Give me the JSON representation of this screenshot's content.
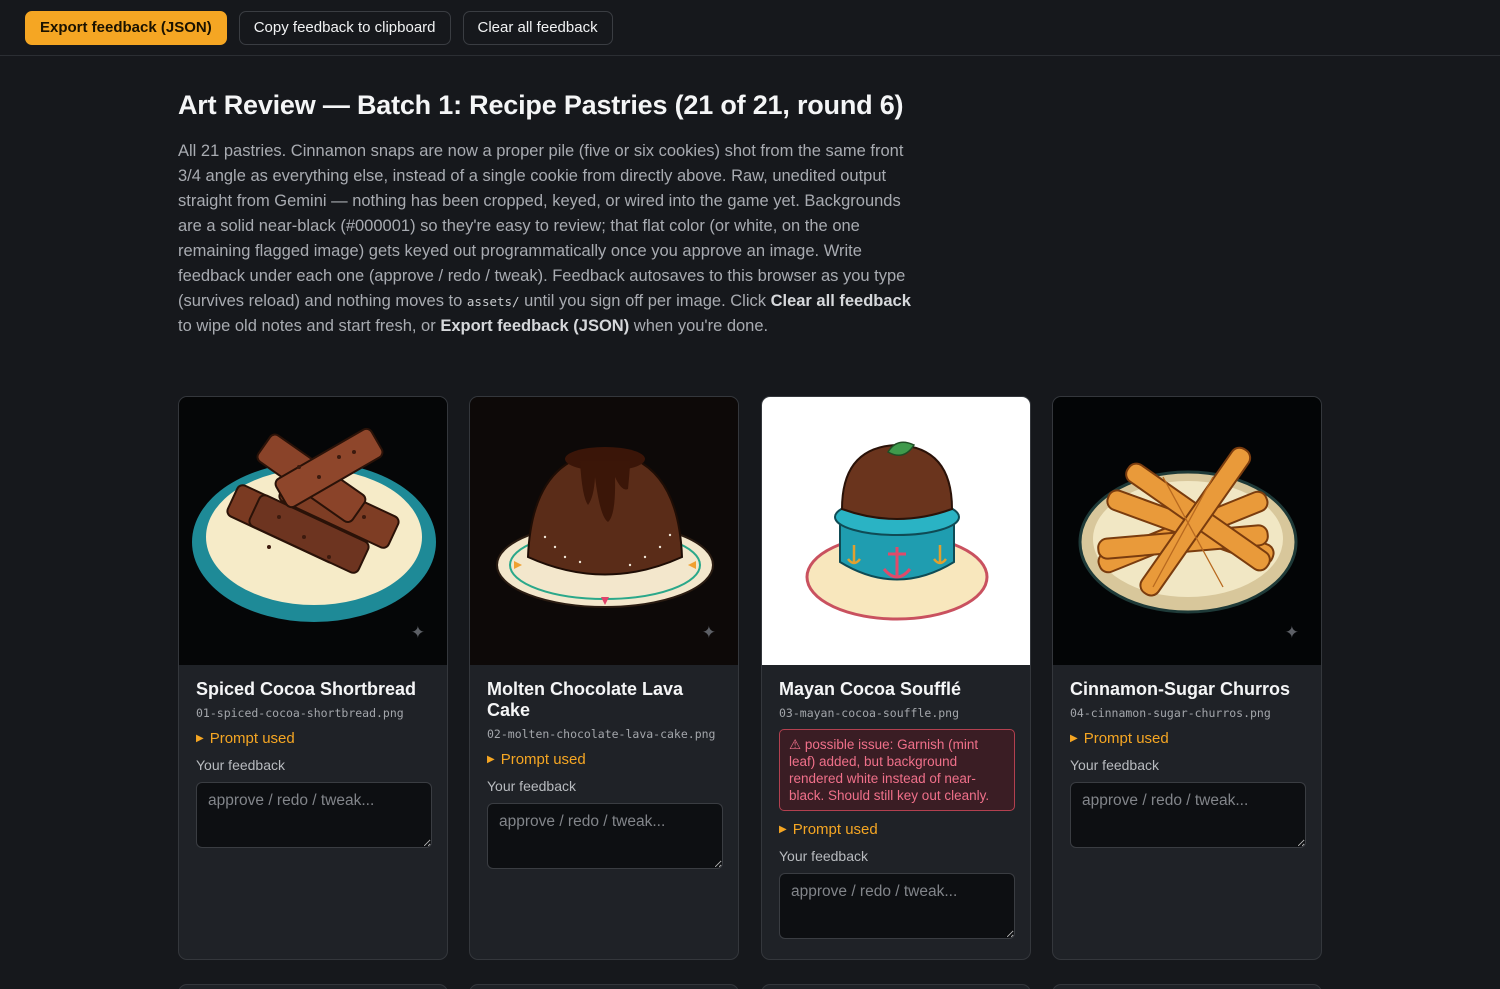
{
  "toolbar": {
    "export_label": "Export feedback (JSON)",
    "copy_label": "Copy feedback to clipboard",
    "clear_label": "Clear all feedback"
  },
  "page": {
    "title": "Art Review — Batch 1: Recipe Pastries (21 of 21, round 6)",
    "intro_a": "All 21 pastries. Cinnamon snaps are now a proper pile (five or six cookies) shot from the same front 3/4 angle as everything else, instead of a single cookie from directly above. Raw, unedited output straight from Gemini — nothing has been cropped, keyed, or wired into the game yet. Backgrounds are a solid near-black (#000001) so they're easy to review; that flat color (or white, on the one remaining flagged image) gets keyed out programmatically once you approve an image. Write feedback under each one (approve / redo / tweak). Feedback autosaves to this browser as you type (survives reload) and nothing moves to ",
    "intro_code": "assets/",
    "intro_b": " until you sign off per image. Click ",
    "intro_clear": "Clear all feedback",
    "intro_c": " to wipe old notes and start fresh, or ",
    "intro_export": "Export feedback (JSON)",
    "intro_d": " when you're done."
  },
  "cards": [
    {
      "title": "Spiced Cocoa Shortbread",
      "file": "01-spiced-cocoa-shortbread.png",
      "prompt_label": "Prompt used",
      "feedback_label": "Your feedback",
      "placeholder": "approve / redo / tweak...",
      "image_icon": "shortbread-image"
    },
    {
      "title": "Molten Chocolate Lava Cake",
      "file": "02-molten-chocolate-lava-cake.png",
      "prompt_label": "Prompt used",
      "feedback_label": "Your feedback",
      "placeholder": "approve / redo / tweak...",
      "image_icon": "lava-cake-image"
    },
    {
      "title": "Mayan Cocoa Soufflé",
      "file": "03-mayan-cocoa-souffle.png",
      "warning": "⚠ possible issue: Garnish (mint leaf) added, but background rendered white instead of near-black. Should still key out cleanly.",
      "prompt_label": "Prompt used",
      "feedback_label": "Your feedback",
      "placeholder": "approve / redo / tweak...",
      "image_icon": "souffle-image"
    },
    {
      "title": "Cinnamon-Sugar Churros",
      "file": "04-cinnamon-sugar-churros.png",
      "prompt_label": "Prompt used",
      "feedback_label": "Your feedback",
      "placeholder": "approve / redo / tweak...",
      "image_icon": "churros-image"
    }
  ],
  "colors": {
    "accent": "#f5a623",
    "warning": "#f0708a",
    "background": "#16181c"
  }
}
